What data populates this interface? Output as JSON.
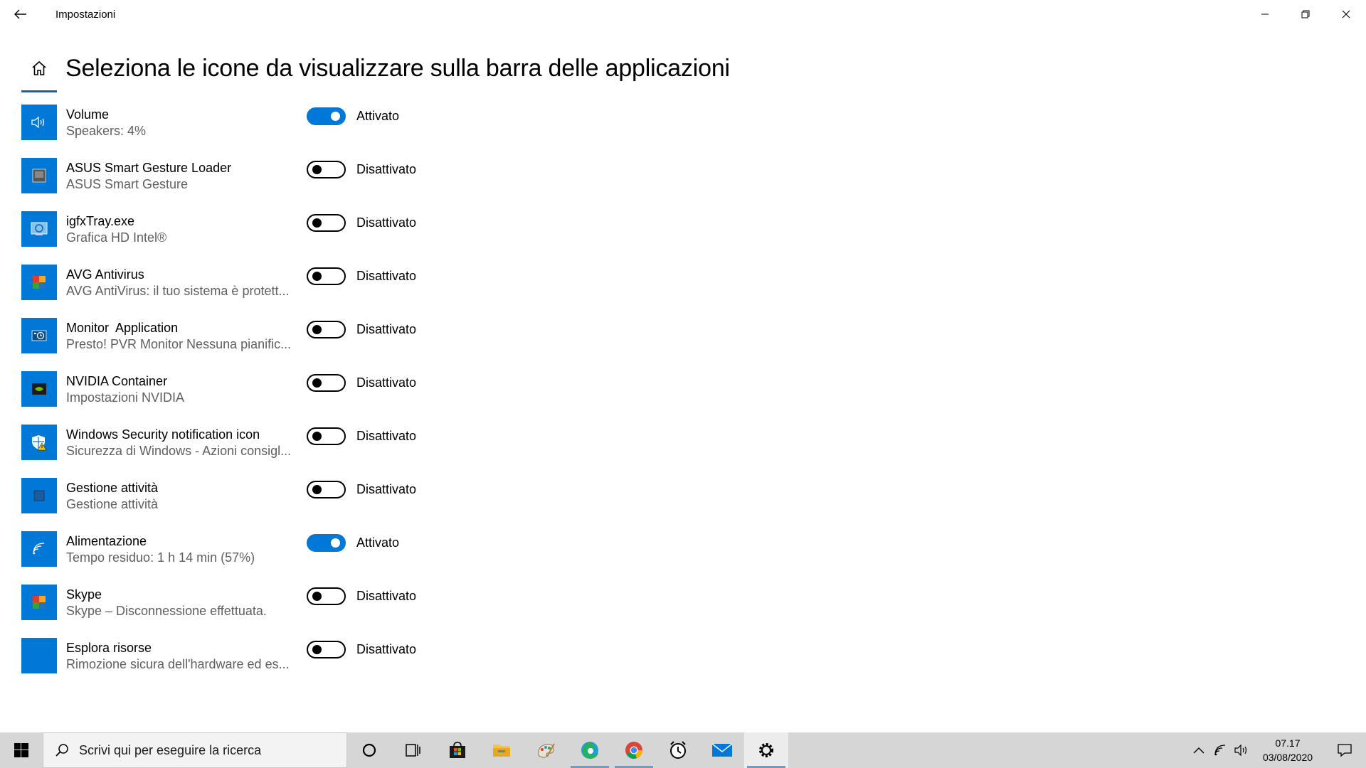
{
  "window": {
    "title": "Impostazioni"
  },
  "header": {
    "title": "Seleziona le icone da visualizzare sulla barra delle applicazioni"
  },
  "colors": {
    "accent": "#0078d7",
    "taskbar": "#d6d6d6"
  },
  "apps": [
    {
      "name": "Volume",
      "subtitle": "Speakers: 4%",
      "state": "Attivato",
      "on": true,
      "icon": "speaker-icon"
    },
    {
      "name": "ASUS Smart Gesture Loader",
      "subtitle": "ASUS Smart Gesture",
      "state": "Disattivato",
      "on": false,
      "icon": "touchpad-icon"
    },
    {
      "name": "igfxTray.exe",
      "subtitle": "Grafica HD Intel®",
      "state": "Disattivato",
      "on": false,
      "icon": "intel-graphics-icon"
    },
    {
      "name": "AVG Antivirus",
      "subtitle": "AVG AntiVirus: il tuo sistema è protett...",
      "state": "Disattivato",
      "on": false,
      "icon": "avg-icon"
    },
    {
      "name": "Monitor  Application",
      "subtitle": "Presto! PVR Monitor Nessuna pianific...",
      "state": "Disattivato",
      "on": false,
      "icon": "monitor-clock-icon"
    },
    {
      "name": "NVIDIA Container",
      "subtitle": "Impostazioni NVIDIA",
      "state": "Disattivato",
      "on": false,
      "icon": "nvidia-icon"
    },
    {
      "name": "Windows Security notification icon",
      "subtitle": "Sicurezza di Windows - Azioni consigl...",
      "state": "Disattivato",
      "on": false,
      "icon": "shield-warning-icon"
    },
    {
      "name": "Gestione attività",
      "subtitle": "Gestione attività",
      "state": "Disattivato",
      "on": false,
      "icon": "task-manager-icon"
    },
    {
      "name": "Alimentazione",
      "subtitle": "Tempo residuo: 1 h 14 min (57%)",
      "state": "Attivato",
      "on": true,
      "icon": "wifi-icon"
    },
    {
      "name": "Skype",
      "subtitle": "Skype – Disconnessione effettuata.",
      "state": "Disattivato",
      "on": false,
      "icon": "colored-squares-icon"
    },
    {
      "name": "Esplora risorse",
      "subtitle": "Rimozione sicura dell'hardware ed es...",
      "state": "Disattivato",
      "on": false,
      "icon": "blank-icon"
    }
  ],
  "taskbar": {
    "search_placeholder": "Scrivi qui per eseguire la ricerca",
    "apps": [
      "cortana-icon",
      "task-view-icon",
      "store-icon",
      "file-explorer-icon",
      "paint-icon",
      "edge-icon",
      "chrome-icon",
      "alarm-clock-icon",
      "mail-icon",
      "settings-icon"
    ],
    "time": "07.17",
    "date": "03/08/2020"
  }
}
